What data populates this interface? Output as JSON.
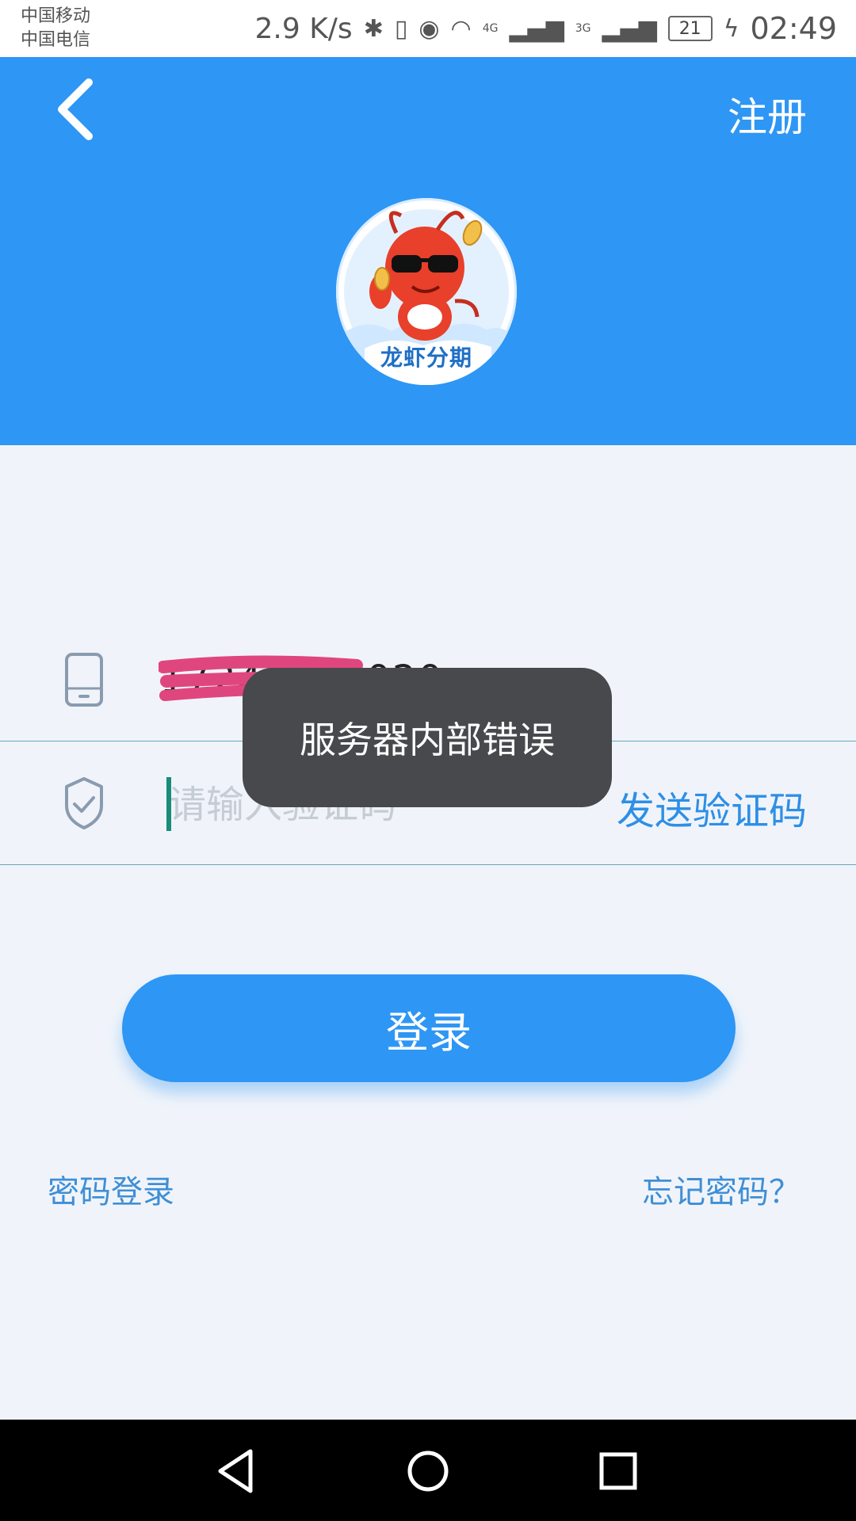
{
  "status_bar": {
    "carrier_1": "中国移动",
    "carrier_2": "中国电信",
    "net_speed": "2.9 K/s",
    "net_4g": "4G",
    "net_3g": "3G",
    "battery": "21",
    "time": "02:49"
  },
  "header": {
    "register_label": "注册",
    "logo_text": "龙虾分期",
    "accent_color": "#2e96f4"
  },
  "form": {
    "phone_value": "17240000020",
    "code_placeholder": "请输入验证码",
    "send_code_label": "发送验证码"
  },
  "toast": {
    "message": "服务器内部错误"
  },
  "actions": {
    "login_label": "登录",
    "password_login_label": "密码登录",
    "forgot_password_label": "忘记密码？"
  },
  "icons": {
    "back": "chevron-left-icon",
    "phone": "phone-icon",
    "shield": "shield-check-icon"
  }
}
